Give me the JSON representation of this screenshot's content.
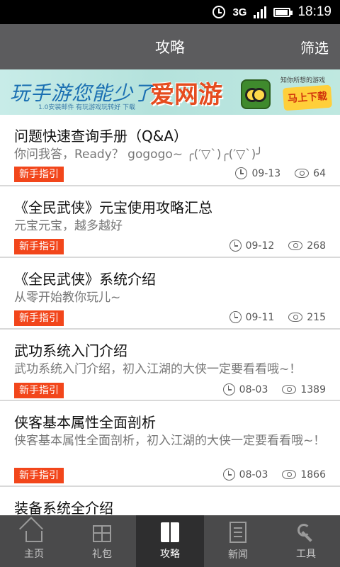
{
  "status_bar": {
    "network": "3G",
    "time": "18:19"
  },
  "header": {
    "title": "攻略",
    "filter_label": "筛选"
  },
  "banner": {
    "slogan": "玩手游您能少了",
    "sub": "1.0安装邮件   有玩游戏玩转好   下载",
    "brand": "爱网游",
    "tagline": "知你所想的游戏",
    "download_label": "马上下载"
  },
  "articles": [
    {
      "title": "问题快速查询手册（Q&A）",
      "desc": "你问我答，Ready？ gogogo~ ╭(′▽`)╭(′▽`)╯",
      "tag": "新手指引",
      "date": "09-13",
      "views": "64"
    },
    {
      "title": "《全民武侠》元宝使用攻略汇总",
      "desc": "元宝元宝，越多越好",
      "tag": "新手指引",
      "date": "09-12",
      "views": "268"
    },
    {
      "title": "《全民武侠》系统介绍",
      "desc": "从零开始教你玩儿~",
      "tag": "新手指引",
      "date": "09-11",
      "views": "215"
    },
    {
      "title": "武功系统入门介绍",
      "desc": "武功系统入门介绍，初入江湖的大侠一定要看看哦~！",
      "tag": "新手指引",
      "date": "08-03",
      "views": "1389"
    },
    {
      "title": "侠客基本属性全面剖析",
      "desc": "侠客基本属性全面剖析，初入江湖的大侠一定要看看哦~！",
      "tag": "新手指引",
      "date": "08-03",
      "views": "1866"
    },
    {
      "title": "装备系统全介绍",
      "desc": "",
      "tag": "",
      "date": "",
      "views": ""
    }
  ],
  "bottom_nav": [
    {
      "label": "主页",
      "icon": "home-icon"
    },
    {
      "label": "礼包",
      "icon": "gift-icon"
    },
    {
      "label": "攻略",
      "icon": "guide-icon",
      "active": true
    },
    {
      "label": "新闻",
      "icon": "news-icon"
    },
    {
      "label": "工具",
      "icon": "tool-icon"
    }
  ]
}
